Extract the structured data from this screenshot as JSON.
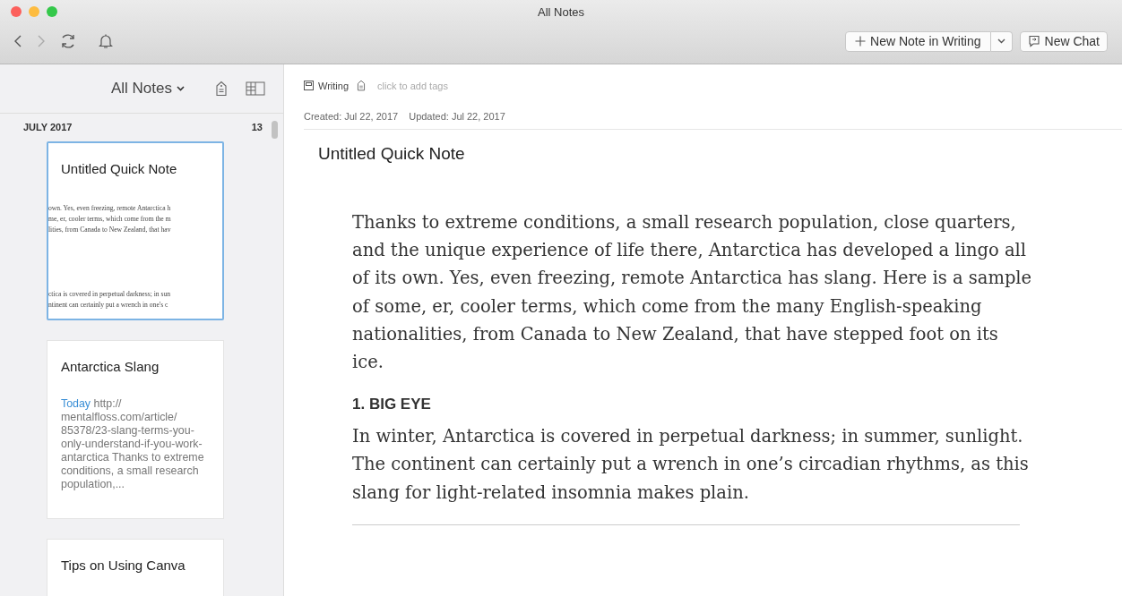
{
  "window": {
    "title": "All Notes"
  },
  "toolbar": {
    "new_note": "New Note in Writing",
    "new_chat": "New Chat"
  },
  "note_list": {
    "title": "All Notes",
    "group": {
      "label": "JULY 2017",
      "count": "13"
    },
    "notes": [
      {
        "title": "Untitled Quick Note",
        "selected": true,
        "kind": "thumbnail",
        "lines": [
          "own. Yes, even freezing, remote Antarctica h",
          "me, er, cooler terms, which come from the m",
          "lities, from Canada to New Zealand, that hav",
          "ctica is covered in perpetual darkness; in sun",
          "ntinent can certainly put a wrench in one's c"
        ]
      },
      {
        "title": "Antarctica Slang",
        "selected": false,
        "kind": "snippet",
        "date": "Today",
        "snippet": "http:// mentalfloss.com/article/ 85378/23-slang-terms-you-only-understand-if-you-work-antarctica Thanks to extreme conditions, a small research population,..."
      },
      {
        "title": "Tips on Using Canva",
        "selected": false,
        "kind": "snippet"
      }
    ]
  },
  "editor": {
    "notebook": "Writing",
    "tags_placeholder": "click to add tags",
    "created": "Created: Jul 22, 2017",
    "updated": "Updated: Jul 22, 2017",
    "title": "Untitled Quick Note",
    "blocks": [
      {
        "kind": "paragraph",
        "text": "Thanks to extreme conditions, a small research population, close quarters, and the unique experience of life there, Antarctica has developed a lingo all of its own. Yes, even freezing, remote Antarctica has slang. Here is a sample of some, er, cooler terms, which come from the many English-speaking nationalities, from Canada to New Zealand, that have stepped foot on its ice."
      },
      {
        "kind": "heading",
        "text": "1. BIG EYE"
      },
      {
        "kind": "paragraph",
        "text": "In winter, Antarctica is covered in perpetual darkness; in summer, sunlight. The continent can certainly put a wrench in one’s circadian rhythms, as this slang for light-related insomnia makes plain."
      }
    ]
  }
}
